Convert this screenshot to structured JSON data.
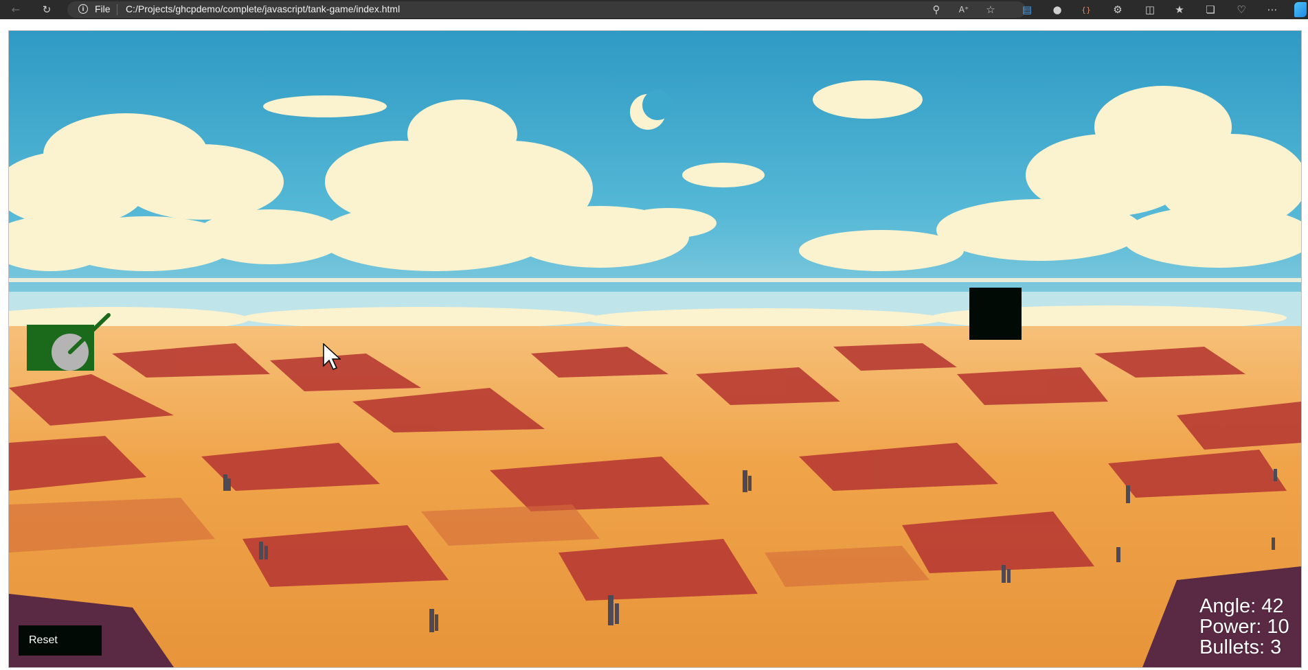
{
  "browser": {
    "scheme_label": "File",
    "url": "C:/Projects/ghcpdemo/complete/javascript/tank-game/index.html",
    "icons": [
      "back-arrow-icon",
      "reload-icon",
      "info-icon",
      "zoom-icon",
      "read-aloud-icon",
      "favorite-star-icon",
      "extension-icon",
      "profile-icon",
      "extension-brackets-icon",
      "puzzle-icon",
      "split-screen-icon",
      "favorites-icon",
      "collections-icon",
      "heart-icon",
      "more-icon",
      "copilot-icon"
    ]
  },
  "game": {
    "reset_label": "Reset",
    "hud": {
      "angle": "Angle: 42",
      "power": "Power: 10",
      "bullets": "Bullets: 3"
    },
    "colors": {
      "tank": "#1b6a1b",
      "turret": "#b4b4b4",
      "enemy": "#020a05",
      "sky": "#3ea7cc",
      "sand": "#f1a648",
      "dune_shadow": "#b63a31"
    }
  }
}
